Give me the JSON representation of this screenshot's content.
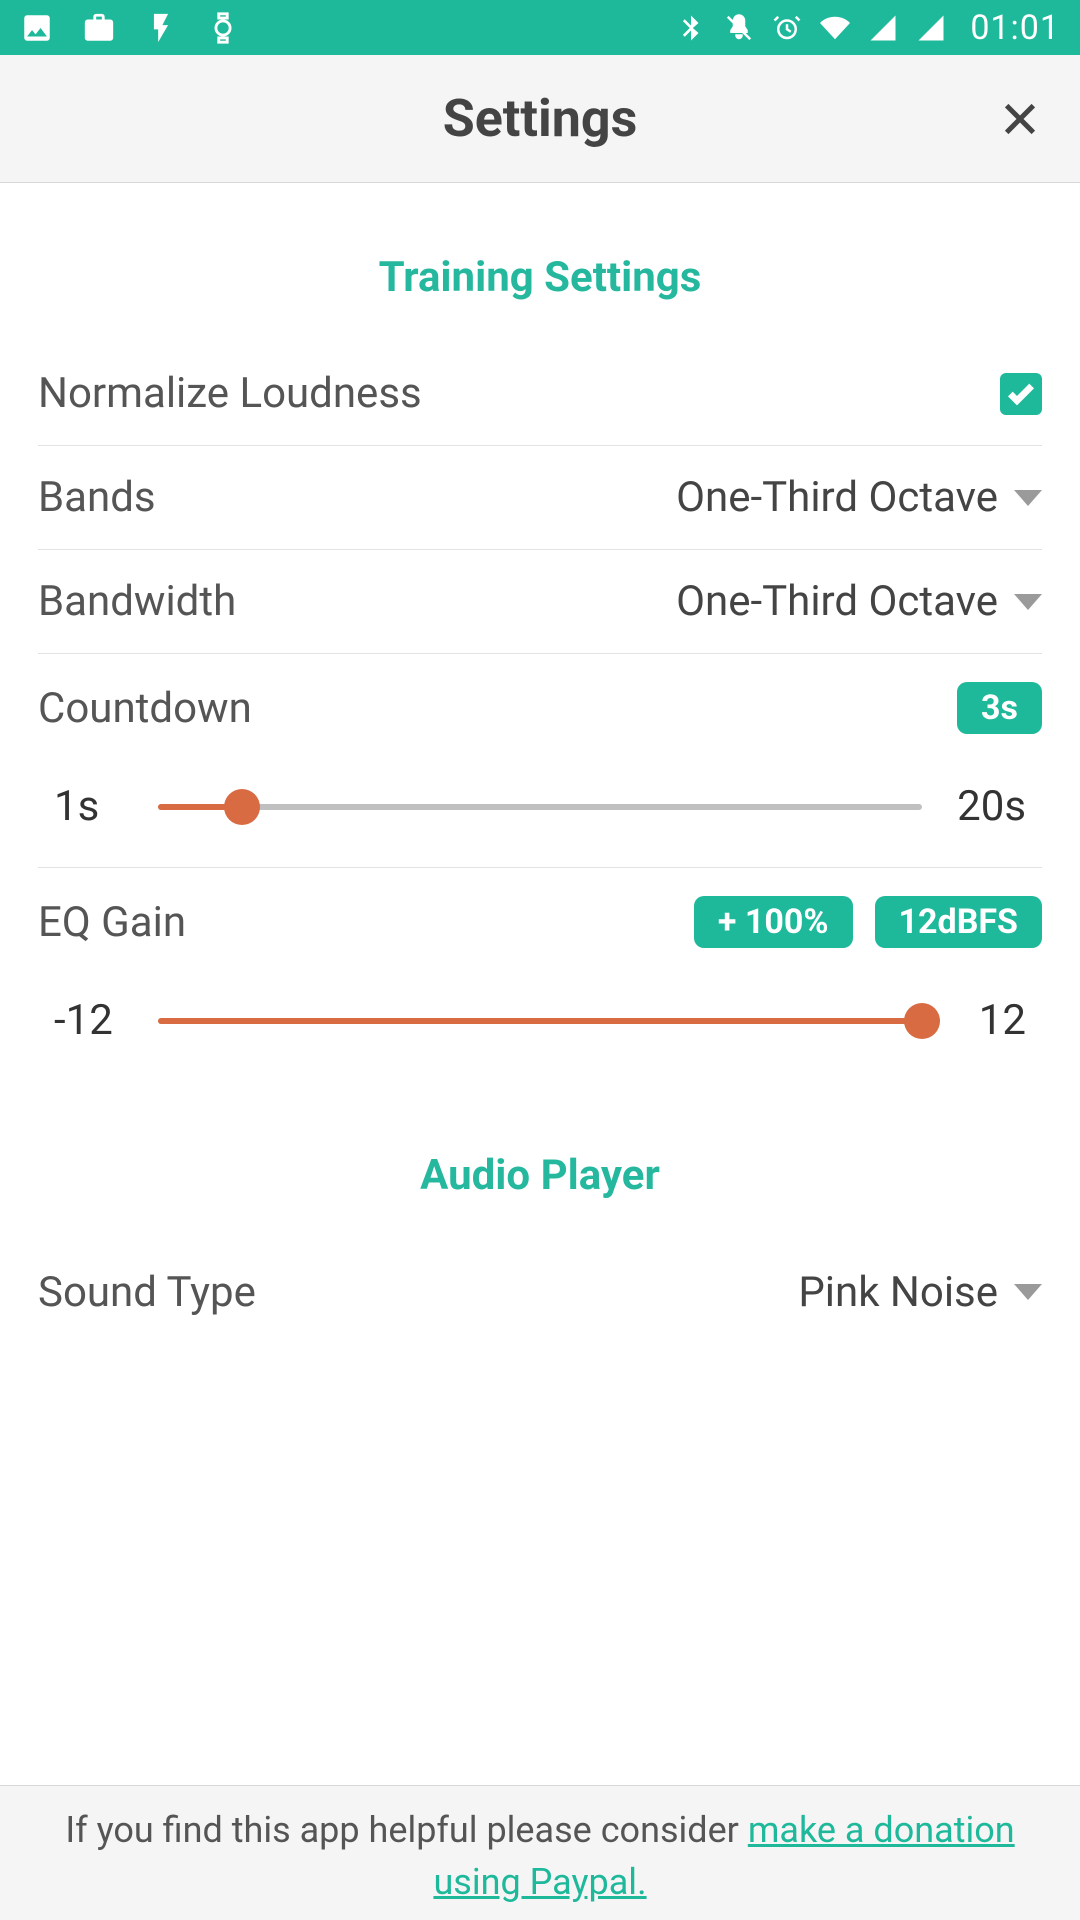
{
  "status_bar": {
    "time": "01:01"
  },
  "header": {
    "title": "Settings"
  },
  "sections": {
    "training": {
      "title": "Training Settings",
      "normalize_label": "Normalize Loudness",
      "normalize_checked": true,
      "bands_label": "Bands",
      "bands_value": "One-Third Octave",
      "bandwidth_label": "Bandwidth",
      "bandwidth_value": "One-Third Octave",
      "countdown_label": "Countdown",
      "countdown_badge": "3s",
      "countdown_min": "1s",
      "countdown_max": "20s",
      "countdown_fill_pct": 11,
      "eqgain_label": "EQ Gain",
      "eqgain_badge1": "+ 100%",
      "eqgain_badge2": "12dBFS",
      "eqgain_min": "-12",
      "eqgain_max": "12",
      "eqgain_fill_pct": 100
    },
    "audio": {
      "title": "Audio Player",
      "sound_type_label": "Sound Type",
      "sound_type_value": "Pink Noise"
    }
  },
  "footer": {
    "prefix": "If you find this app helpful please consider ",
    "link": "make a donation using Paypal."
  }
}
